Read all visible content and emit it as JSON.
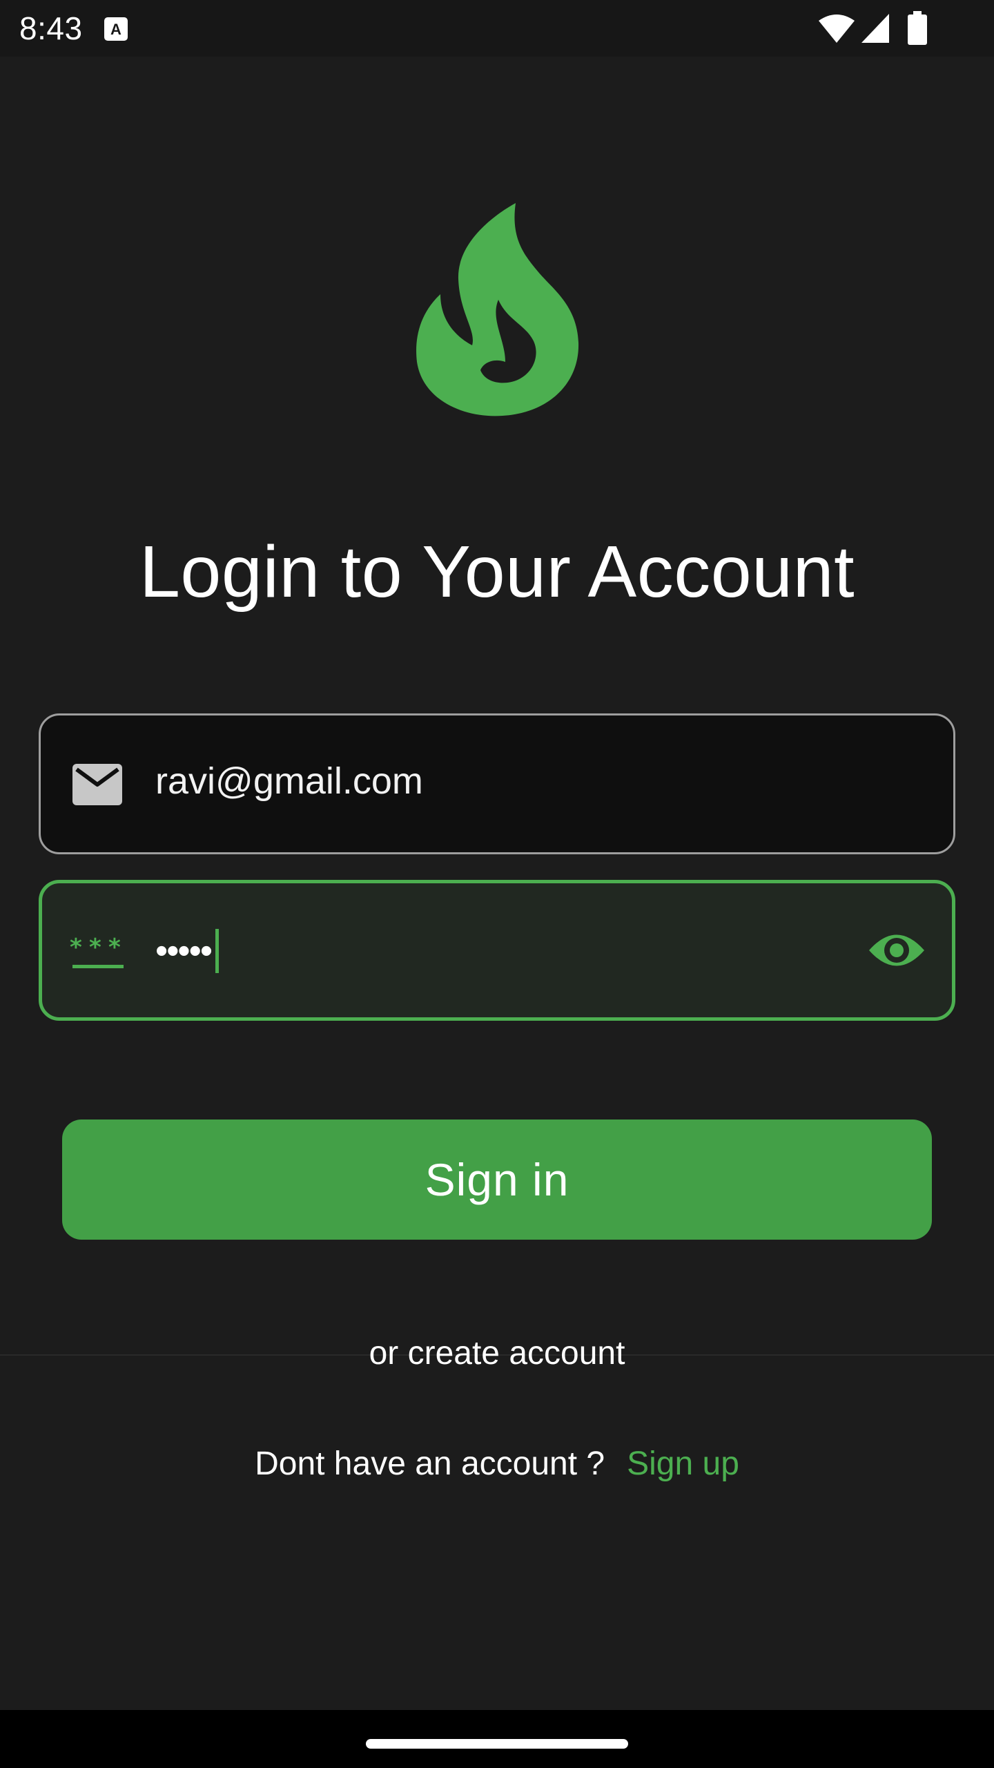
{
  "status_bar": {
    "time": "8:43",
    "icons": [
      "keyboard-a-icon",
      "wifi-icon",
      "signal-icon",
      "battery-icon"
    ]
  },
  "logo": {
    "icon": "flame-logo-icon",
    "color": "#4caf50"
  },
  "title": "Login to Your Account",
  "email_field": {
    "icon": "email-icon",
    "value": "ravi@gmail.com"
  },
  "password_field": {
    "icon": "password-asterisk-icon",
    "value": "•••••",
    "toggle_icon": "eye-icon"
  },
  "sign_in_button": {
    "label": "Sign in"
  },
  "divider": {
    "text": "or create account"
  },
  "signup": {
    "prompt": "Dont have an account ?",
    "link": "Sign up"
  },
  "colors": {
    "accent": "#4caf50",
    "button": "#43a047",
    "background": "#1c1c1c"
  }
}
